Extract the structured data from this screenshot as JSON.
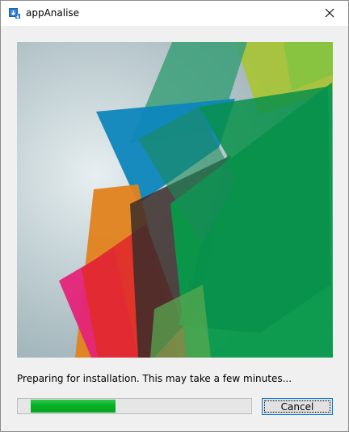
{
  "window": {
    "title": "appAnalise",
    "icon": "installer-app-icon",
    "close_icon": "close-icon"
  },
  "banner": {
    "description_icon": "abstract-banner-art"
  },
  "status": {
    "message": "Preparing for installation. This may take a few minutes..."
  },
  "progress": {
    "percent": 44,
    "color": "#06b025"
  },
  "buttons": {
    "cancel_label": "Cancel"
  },
  "colors": {
    "accent": "#0078d7",
    "window_bg": "#f0f0f0"
  }
}
